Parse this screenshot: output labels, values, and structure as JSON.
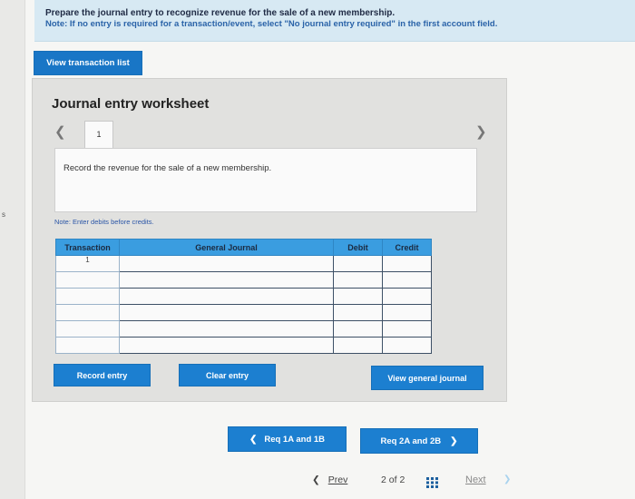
{
  "margin_mark": "s",
  "instructions": {
    "line1": "Prepare the journal entry to recognize revenue for the sale of a new membership.",
    "note": "Note: If no entry is required for a transaction/event, select \"No journal entry required\" in the first account field."
  },
  "buttons": {
    "view_transaction_list": "View transaction list",
    "record_entry": "Record entry",
    "clear_entry": "Clear entry",
    "view_general_journal": "View general journal",
    "req_prev": "Req 1A and 1B",
    "req_next": "Req 2A and 2B"
  },
  "worksheet": {
    "title": "Journal entry worksheet",
    "tab_number": "1",
    "description": "Record the revenue for the sale of a new membership.",
    "note": "Note: Enter debits before credits."
  },
  "table": {
    "headers": [
      "Transaction",
      "General Journal",
      "Debit",
      "Credit"
    ],
    "rows": [
      {
        "transaction": "1"
      },
      {
        "transaction": ""
      },
      {
        "transaction": ""
      },
      {
        "transaction": ""
      },
      {
        "transaction": ""
      },
      {
        "transaction": ""
      }
    ]
  },
  "pager": {
    "prev_label": "Prev",
    "page_current": "2",
    "page_of": "of",
    "page_total": "2",
    "next_label": "Next"
  },
  "colors": {
    "accent": "#1c7fd0",
    "table_header": "#3a9de0",
    "instruction_bg": "#d7e9f3"
  }
}
